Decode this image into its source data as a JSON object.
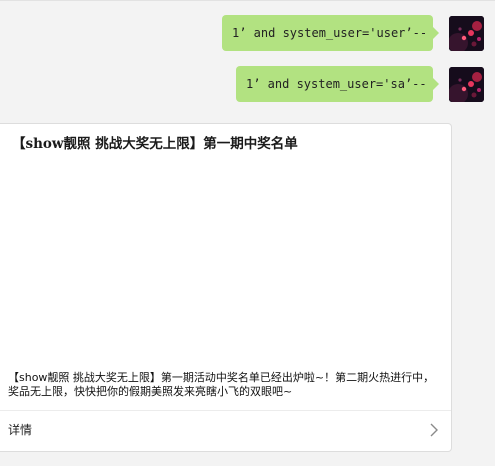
{
  "messages": [
    {
      "text": "1’ and system_user='user’--",
      "sender": "self",
      "avatar_icon": "user-avatar-icon"
    },
    {
      "text": "1’ and system_user='sa’--",
      "sender": "self",
      "avatar_icon": "user-avatar-icon"
    }
  ],
  "card": {
    "title": "【show靓照 挑战大奖无上限】第一期中奖名单",
    "description": "【show靓照 挑战大奖无上限】第一期活动中奖名单已经出炉啦~！第二期火热进行中，奖品无上限，快快把你的假期美照发来亮瞎小飞的双眼吧~",
    "detail_label": "详情",
    "detail_icon": "chevron-right-icon"
  },
  "colors": {
    "background": "#f3f3f3",
    "bubble": "#b2e281",
    "card": "#ffffff"
  }
}
